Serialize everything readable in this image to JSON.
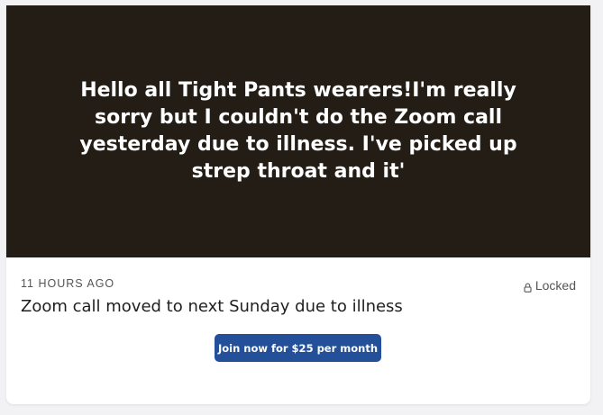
{
  "post": {
    "preview_text": "Hello all Tight Pants wearers!I'm really sorry but I couldn't do the Zoom call yesterday due to illness. I've picked up strep throat and it'",
    "timestamp": "11 HOURS AGO",
    "lock_status": "Locked",
    "title": "Zoom call moved to next Sunday due to illness",
    "join_label": "Join now for $25 per month"
  },
  "colors": {
    "hero_background": "#231d15",
    "button_background": "#24509a",
    "page_background": "#f2f2f4"
  },
  "icons": {
    "lock": "lock-icon"
  }
}
